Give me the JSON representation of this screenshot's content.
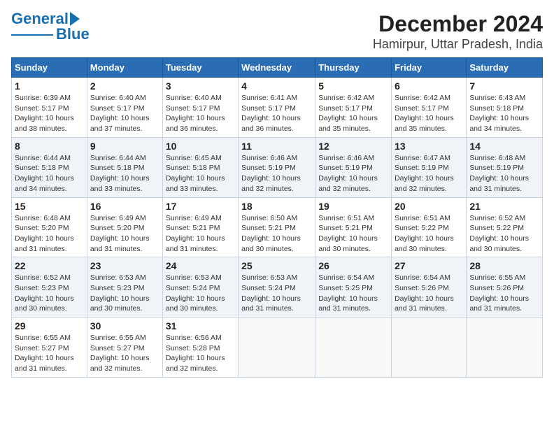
{
  "header": {
    "logo_line1": "General",
    "logo_line2": "Blue",
    "title": "December 2024",
    "subtitle": "Hamirpur, Uttar Pradesh, India"
  },
  "days_of_week": [
    "Sunday",
    "Monday",
    "Tuesday",
    "Wednesday",
    "Thursday",
    "Friday",
    "Saturday"
  ],
  "weeks": [
    [
      {
        "day": 1,
        "info": "Sunrise: 6:39 AM\nSunset: 5:17 PM\nDaylight: 10 hours and 38 minutes."
      },
      {
        "day": 2,
        "info": "Sunrise: 6:40 AM\nSunset: 5:17 PM\nDaylight: 10 hours and 37 minutes."
      },
      {
        "day": 3,
        "info": "Sunrise: 6:40 AM\nSunset: 5:17 PM\nDaylight: 10 hours and 36 minutes."
      },
      {
        "day": 4,
        "info": "Sunrise: 6:41 AM\nSunset: 5:17 PM\nDaylight: 10 hours and 36 minutes."
      },
      {
        "day": 5,
        "info": "Sunrise: 6:42 AM\nSunset: 5:17 PM\nDaylight: 10 hours and 35 minutes."
      },
      {
        "day": 6,
        "info": "Sunrise: 6:42 AM\nSunset: 5:17 PM\nDaylight: 10 hours and 35 minutes."
      },
      {
        "day": 7,
        "info": "Sunrise: 6:43 AM\nSunset: 5:18 PM\nDaylight: 10 hours and 34 minutes."
      }
    ],
    [
      {
        "day": 8,
        "info": "Sunrise: 6:44 AM\nSunset: 5:18 PM\nDaylight: 10 hours and 34 minutes."
      },
      {
        "day": 9,
        "info": "Sunrise: 6:44 AM\nSunset: 5:18 PM\nDaylight: 10 hours and 33 minutes."
      },
      {
        "day": 10,
        "info": "Sunrise: 6:45 AM\nSunset: 5:18 PM\nDaylight: 10 hours and 33 minutes."
      },
      {
        "day": 11,
        "info": "Sunrise: 6:46 AM\nSunset: 5:19 PM\nDaylight: 10 hours and 32 minutes."
      },
      {
        "day": 12,
        "info": "Sunrise: 6:46 AM\nSunset: 5:19 PM\nDaylight: 10 hours and 32 minutes."
      },
      {
        "day": 13,
        "info": "Sunrise: 6:47 AM\nSunset: 5:19 PM\nDaylight: 10 hours and 32 minutes."
      },
      {
        "day": 14,
        "info": "Sunrise: 6:48 AM\nSunset: 5:19 PM\nDaylight: 10 hours and 31 minutes."
      }
    ],
    [
      {
        "day": 15,
        "info": "Sunrise: 6:48 AM\nSunset: 5:20 PM\nDaylight: 10 hours and 31 minutes."
      },
      {
        "day": 16,
        "info": "Sunrise: 6:49 AM\nSunset: 5:20 PM\nDaylight: 10 hours and 31 minutes."
      },
      {
        "day": 17,
        "info": "Sunrise: 6:49 AM\nSunset: 5:21 PM\nDaylight: 10 hours and 31 minutes."
      },
      {
        "day": 18,
        "info": "Sunrise: 6:50 AM\nSunset: 5:21 PM\nDaylight: 10 hours and 30 minutes."
      },
      {
        "day": 19,
        "info": "Sunrise: 6:51 AM\nSunset: 5:21 PM\nDaylight: 10 hours and 30 minutes."
      },
      {
        "day": 20,
        "info": "Sunrise: 6:51 AM\nSunset: 5:22 PM\nDaylight: 10 hours and 30 minutes."
      },
      {
        "day": 21,
        "info": "Sunrise: 6:52 AM\nSunset: 5:22 PM\nDaylight: 10 hours and 30 minutes."
      }
    ],
    [
      {
        "day": 22,
        "info": "Sunrise: 6:52 AM\nSunset: 5:23 PM\nDaylight: 10 hours and 30 minutes."
      },
      {
        "day": 23,
        "info": "Sunrise: 6:53 AM\nSunset: 5:23 PM\nDaylight: 10 hours and 30 minutes."
      },
      {
        "day": 24,
        "info": "Sunrise: 6:53 AM\nSunset: 5:24 PM\nDaylight: 10 hours and 30 minutes."
      },
      {
        "day": 25,
        "info": "Sunrise: 6:53 AM\nSunset: 5:24 PM\nDaylight: 10 hours and 31 minutes."
      },
      {
        "day": 26,
        "info": "Sunrise: 6:54 AM\nSunset: 5:25 PM\nDaylight: 10 hours and 31 minutes."
      },
      {
        "day": 27,
        "info": "Sunrise: 6:54 AM\nSunset: 5:26 PM\nDaylight: 10 hours and 31 minutes."
      },
      {
        "day": 28,
        "info": "Sunrise: 6:55 AM\nSunset: 5:26 PM\nDaylight: 10 hours and 31 minutes."
      }
    ],
    [
      {
        "day": 29,
        "info": "Sunrise: 6:55 AM\nSunset: 5:27 PM\nDaylight: 10 hours and 31 minutes."
      },
      {
        "day": 30,
        "info": "Sunrise: 6:55 AM\nSunset: 5:27 PM\nDaylight: 10 hours and 32 minutes."
      },
      {
        "day": 31,
        "info": "Sunrise: 6:56 AM\nSunset: 5:28 PM\nDaylight: 10 hours and 32 minutes."
      },
      null,
      null,
      null,
      null
    ]
  ]
}
